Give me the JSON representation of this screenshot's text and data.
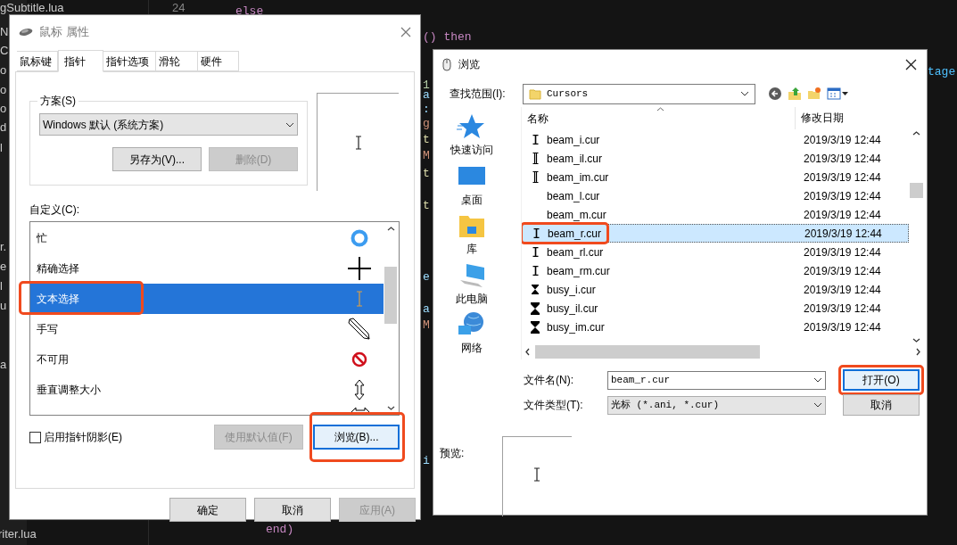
{
  "editor": {
    "file_fragments": [
      "gSubtitle.lua",
      "N",
      "C",
      "o",
      "o",
      "o",
      "d",
      "l",
      "r.",
      "e",
      "l",
      "u",
      "a",
      "riter.lua"
    ],
    "line_numbers": [
      "24"
    ],
    "code_fragments": [
      "else",
      "() then",
      "tage",
      "1",
      "a",
      ":",
      "g",
      "t",
      "M",
      "t",
      "t",
      "e",
      "a",
      "M",
      "i",
      "end)"
    ]
  },
  "mouse_properties": {
    "title": "鼠标 属性",
    "tabs": [
      {
        "label": "鼠标键",
        "selected": false
      },
      {
        "label": "指针",
        "selected": true
      },
      {
        "label": "指针选项",
        "selected": false
      },
      {
        "label": "滑轮",
        "selected": false
      },
      {
        "label": "硬件",
        "selected": false
      }
    ],
    "scheme": {
      "label": "方案(S)",
      "value": "Windows 默认 (系统方案)",
      "buttons": [
        {
          "label": "另存为(V)...",
          "disabled": false
        },
        {
          "label": "删除(D)",
          "disabled": true
        }
      ]
    },
    "customize_label": "自定义(C):",
    "pointers": [
      {
        "label": "忙",
        "selected": false,
        "highlighted": false
      },
      {
        "label": "精确选择",
        "selected": false,
        "highlighted": false
      },
      {
        "label": "文本选择",
        "selected": true,
        "highlighted": true
      },
      {
        "label": "手写",
        "selected": false,
        "highlighted": false
      },
      {
        "label": "不可用",
        "selected": false,
        "highlighted": false
      },
      {
        "label": "垂直调整大小",
        "selected": false,
        "highlighted": false
      }
    ],
    "shadow": {
      "label": "启用指针阴影(E)",
      "checked": false
    },
    "buttons": [
      {
        "label": "使用默认值(F)",
        "disabled": true,
        "focused": false,
        "highlighted": false
      },
      {
        "label": "浏览(B)...",
        "disabled": false,
        "focused": true,
        "highlighted": true
      }
    ],
    "footer_buttons": [
      {
        "label": "确定",
        "disabled": false
      },
      {
        "label": "取消",
        "disabled": false
      },
      {
        "label": "应用(A)",
        "disabled": true
      }
    ]
  },
  "browse": {
    "title": "浏览",
    "look_in": {
      "label": "查找范围(I):",
      "value": "Cursors"
    },
    "places": [
      "快速访问",
      "桌面",
      "库",
      "此电脑",
      "网络"
    ],
    "columns": [
      "名称",
      "修改日期"
    ],
    "files": [
      {
        "name": "beam_i.cur",
        "date": "2019/3/19 12:44",
        "selected": false,
        "highlighted": false
      },
      {
        "name": "beam_il.cur",
        "date": "2019/3/19 12:44",
        "selected": false,
        "highlighted": false
      },
      {
        "name": "beam_im.cur",
        "date": "2019/3/19 12:44",
        "selected": false,
        "highlighted": false
      },
      {
        "name": "beam_l.cur",
        "date": "2019/3/19 12:44",
        "selected": false,
        "highlighted": false
      },
      {
        "name": "beam_m.cur",
        "date": "2019/3/19 12:44",
        "selected": false,
        "highlighted": false
      },
      {
        "name": "beam_r.cur",
        "date": "2019/3/19 12:44",
        "selected": true,
        "highlighted": true
      },
      {
        "name": "beam_rl.cur",
        "date": "2019/3/19 12:44",
        "selected": false,
        "highlighted": false
      },
      {
        "name": "beam_rm.cur",
        "date": "2019/3/19 12:44",
        "selected": false,
        "highlighted": false
      },
      {
        "name": "busy_i.cur",
        "date": "2019/3/19 12:44",
        "selected": false,
        "highlighted": false
      },
      {
        "name": "busy_il.cur",
        "date": "2019/3/19 12:44",
        "selected": false,
        "highlighted": false
      },
      {
        "name": "busy_im.cur",
        "date": "2019/3/19 12:44",
        "selected": false,
        "highlighted": false
      }
    ],
    "file_name": {
      "label": "文件名(N):",
      "value": "beam_r.cur"
    },
    "file_type": {
      "label": "文件类型(T):",
      "value": "光标 (*.ani, *.cur)"
    },
    "buttons": [
      {
        "label": "打开(O)",
        "focused": true,
        "highlighted": true
      },
      {
        "label": "取消",
        "focused": false,
        "highlighted": false
      }
    ],
    "preview_label": "预览:"
  }
}
